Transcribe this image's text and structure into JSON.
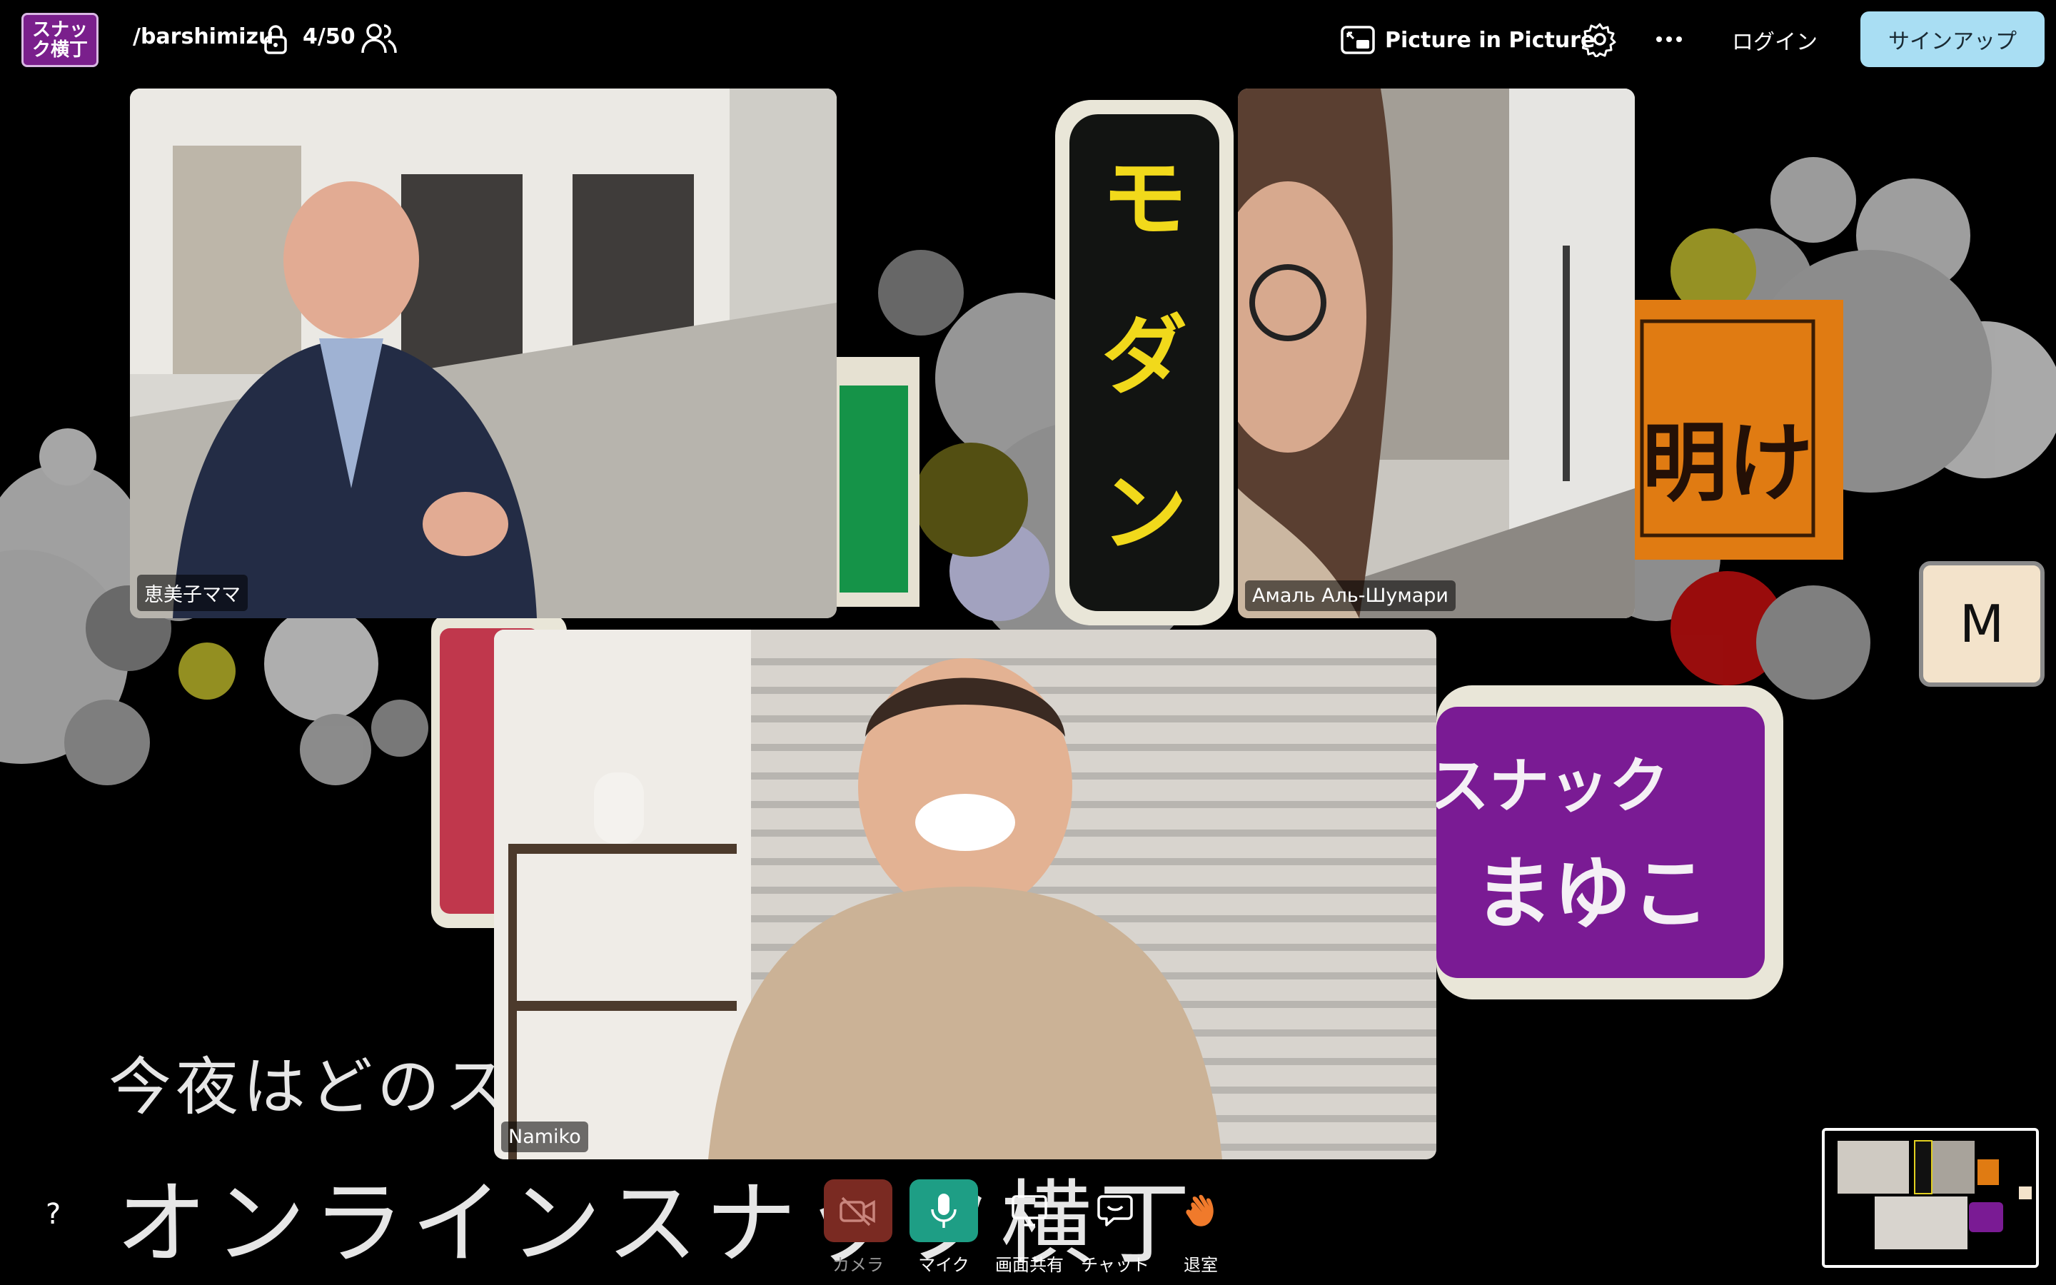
{
  "header": {
    "room_name": "/barshimizu",
    "participant_count": "4/50",
    "pip_label": "Picture in Picture",
    "login_label": "ログイン",
    "signup_label": "サインアップ",
    "logo_text": "スナック横丁"
  },
  "background": {
    "headline_small": "今夜はどのス",
    "headline_large": "オンラインスナック横丁",
    "signs": [
      "モダン",
      "スナック まゆこ",
      "明け"
    ]
  },
  "tiles": [
    {
      "name": "恵美子ママ"
    },
    {
      "name": "Амаль Аль-Шумари"
    },
    {
      "name": "Namiko"
    }
  ],
  "avatar": {
    "initial": "M"
  },
  "controls": {
    "camera": "カメラ",
    "mic": "マイク",
    "share": "画面共有",
    "chat": "チャット",
    "leave": "退室",
    "help": "?"
  },
  "colors": {
    "signup_bg": "#a9def3",
    "mic_active": "#1e9e85",
    "camera_off": "#7a2a22"
  }
}
